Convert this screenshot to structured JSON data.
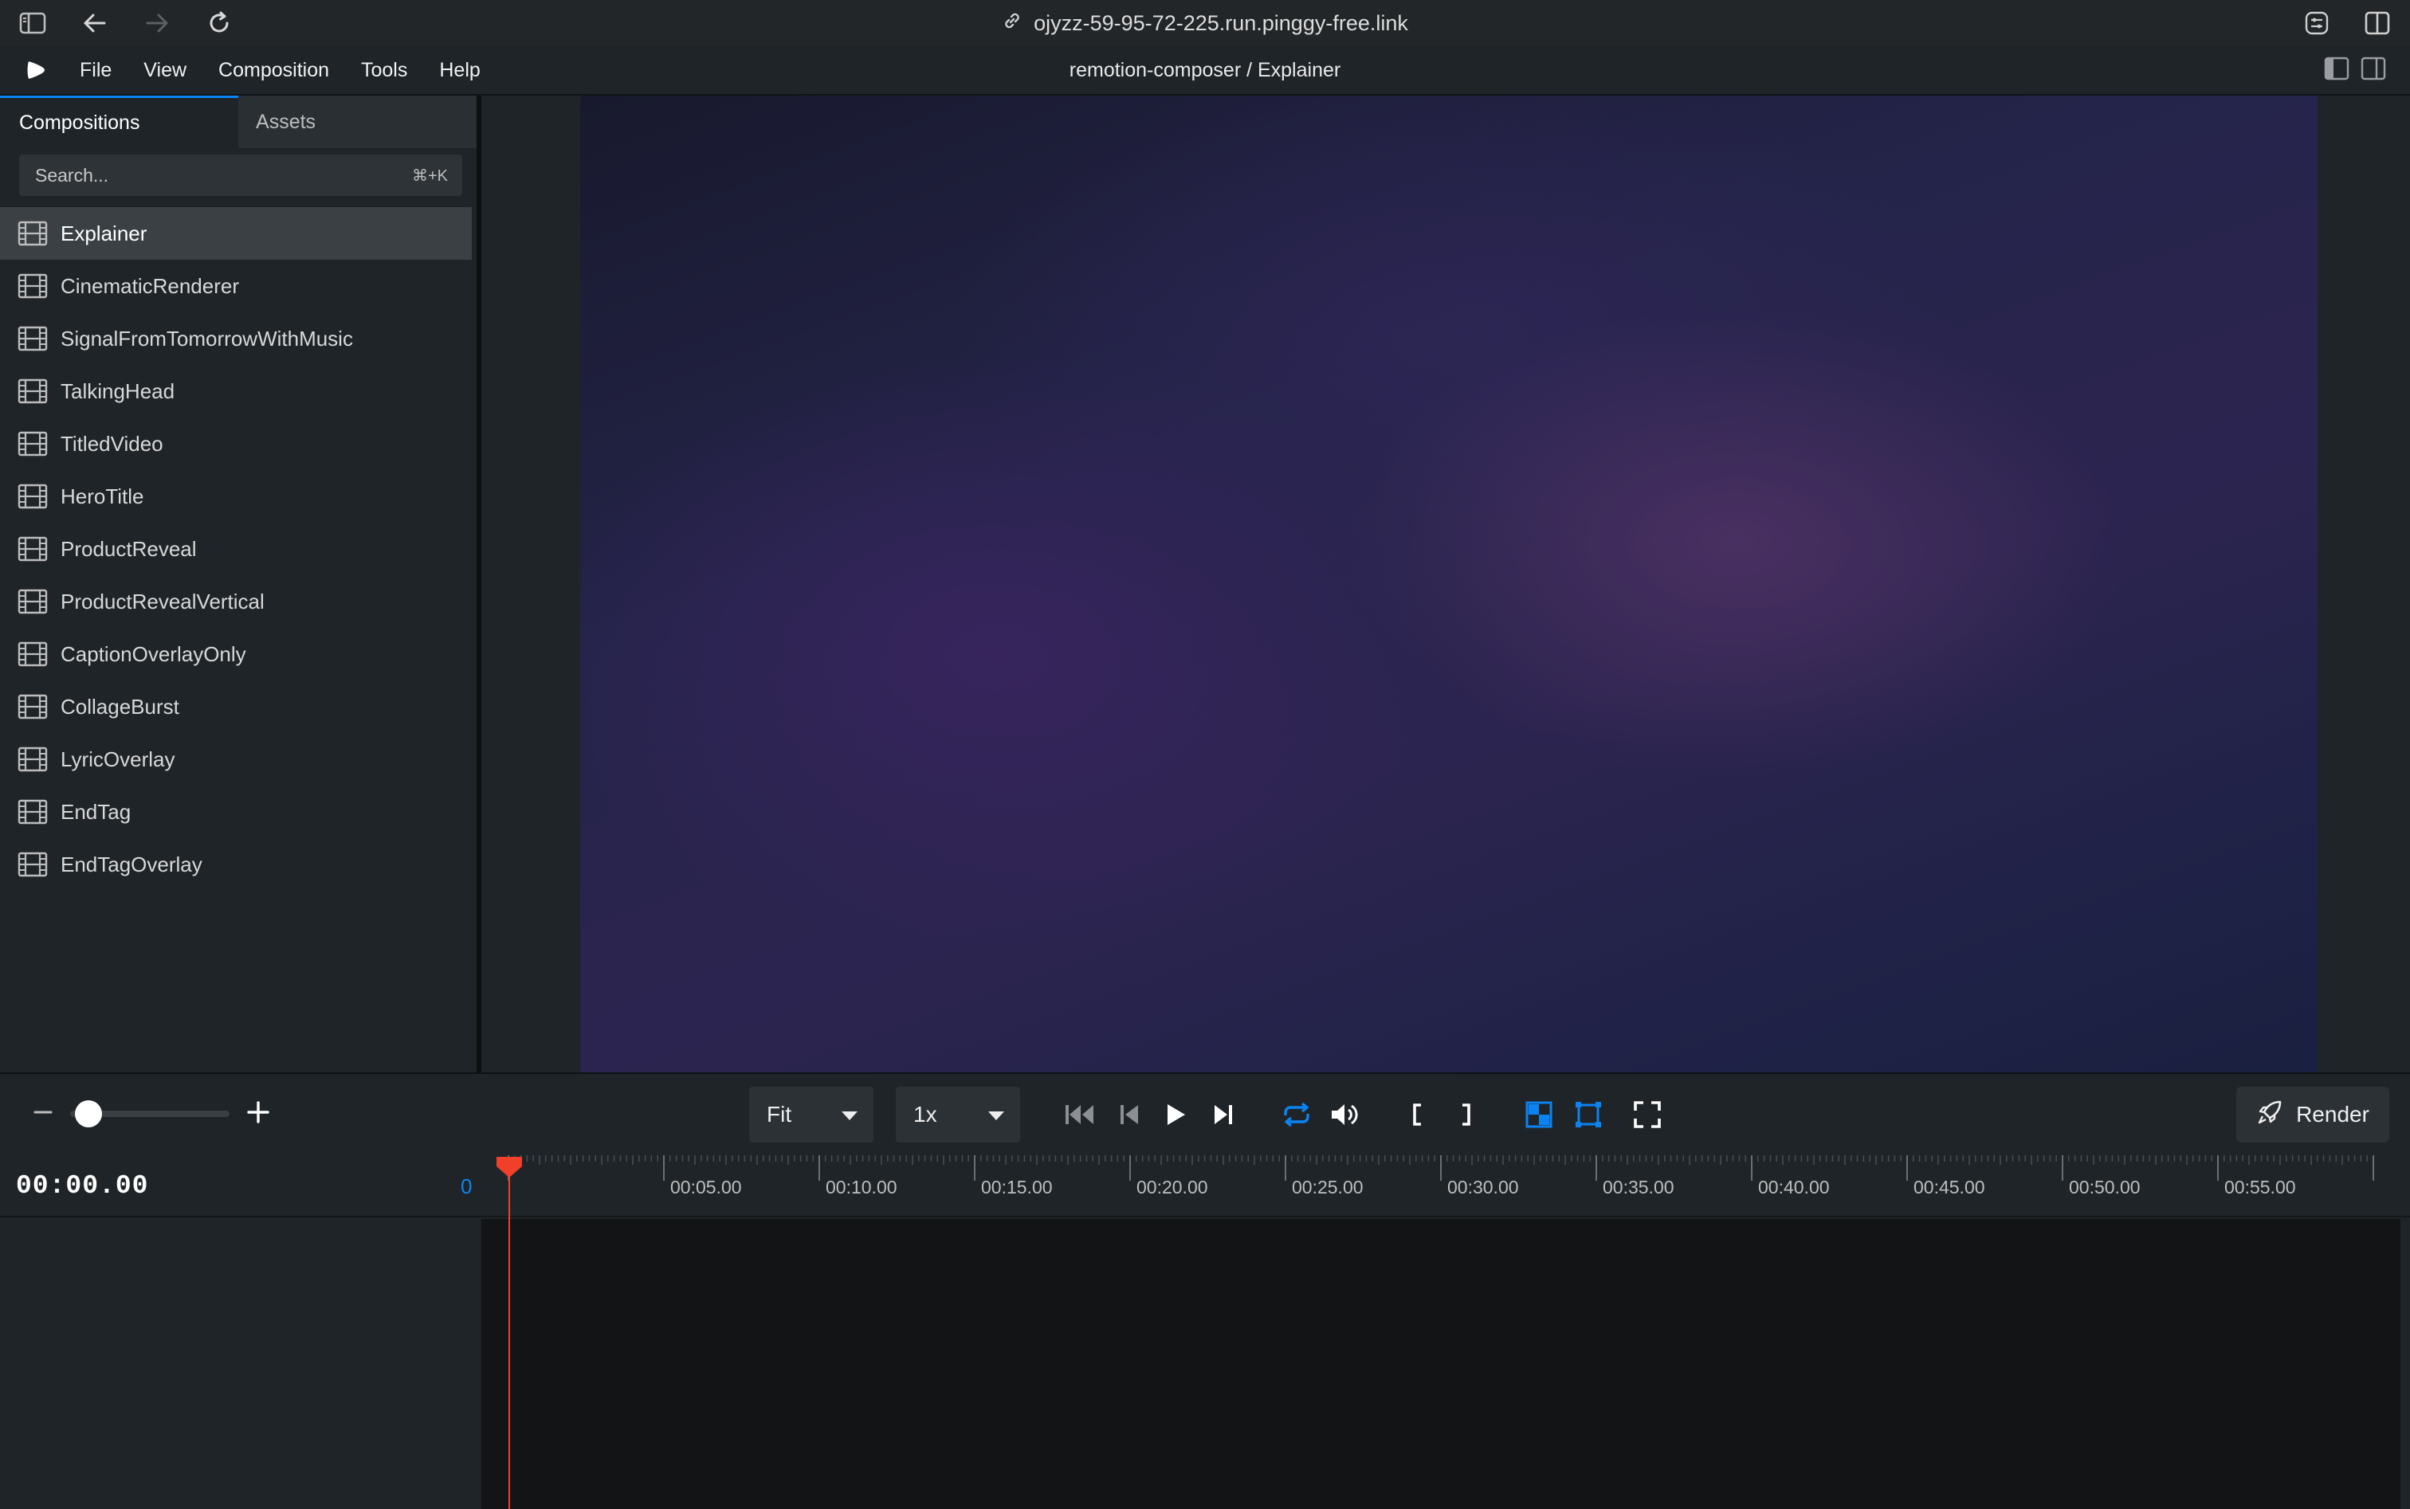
{
  "browser": {
    "url": "ojyzz-59-95-72-225.run.pinggy-free.link"
  },
  "menu": {
    "items": [
      "File",
      "View",
      "Composition",
      "Tools",
      "Help"
    ],
    "title": "remotion-composer / Explainer"
  },
  "sidebar": {
    "tabs": [
      "Compositions",
      "Assets"
    ],
    "search_placeholder": "Search...",
    "search_shortcut": "⌘+K",
    "compositions": [
      "Explainer",
      "CinematicRenderer",
      "SignalFromTomorrowWithMusic",
      "TalkingHead",
      "TitledVideo",
      "HeroTitle",
      "ProductReveal",
      "ProductRevealVertical",
      "CaptionOverlayOnly",
      "CollageBurst",
      "LyricOverlay",
      "EndTag",
      "EndTagOverlay"
    ],
    "selected": "Explainer"
  },
  "controls": {
    "size_select": "Fit",
    "speed_select": "1x",
    "render_label": "Render",
    "accent_color": "#0b84f3"
  },
  "timeline": {
    "timecode": "00:00.00",
    "frame": "0",
    "ticks": [
      "00:05.00",
      "00:10.00",
      "00:15.00",
      "00:20.00",
      "00:25.00",
      "00:30.00",
      "00:35.00",
      "00:40.00",
      "00:45.00",
      "00:50.00",
      "00:55.00"
    ],
    "playhead_color": "#f0402a"
  }
}
